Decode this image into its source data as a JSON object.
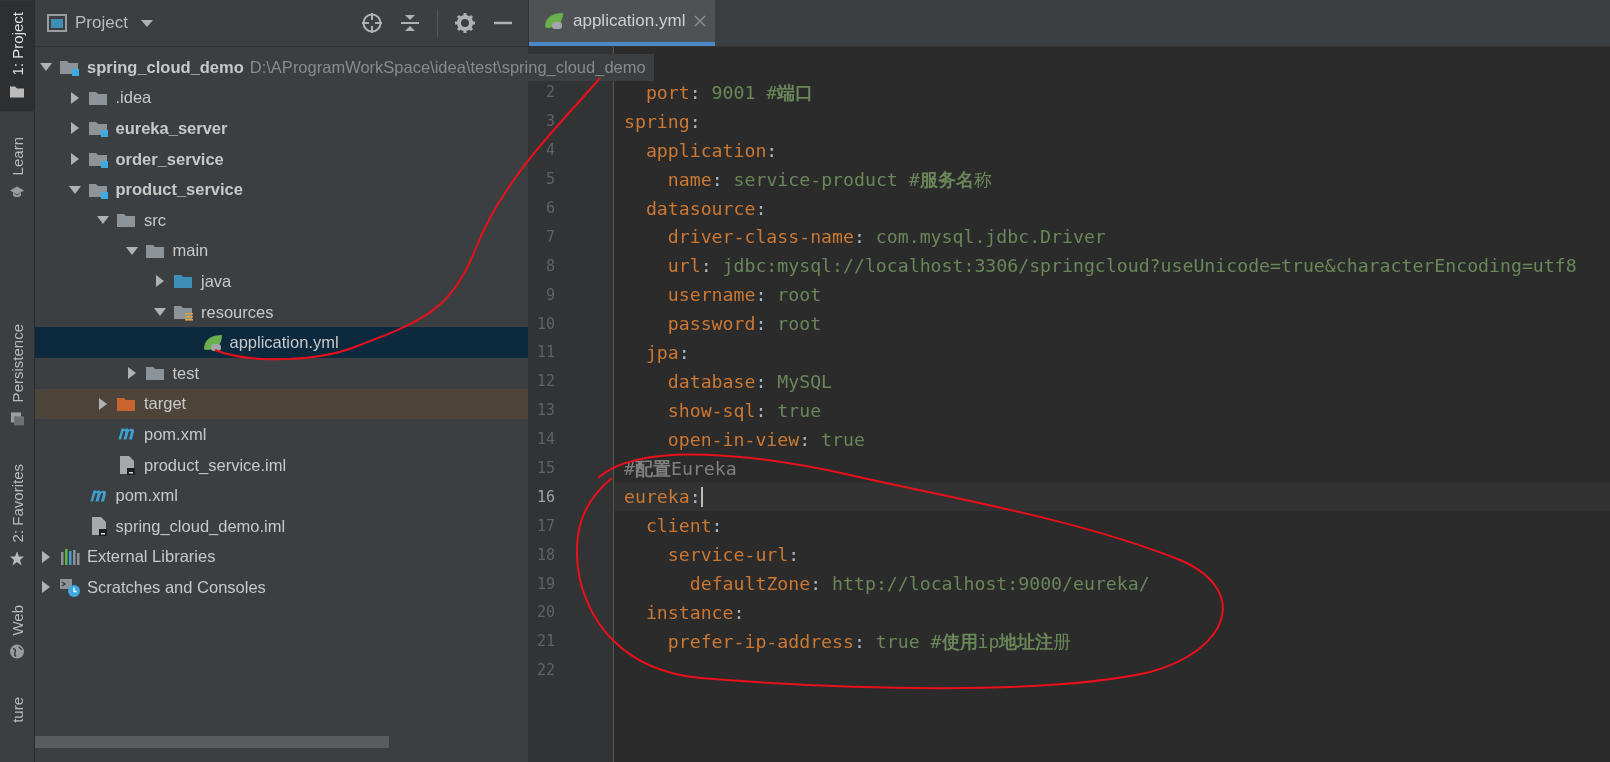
{
  "tool_tabs": [
    {
      "label": "1: Project",
      "selected": true
    },
    {
      "label": "Learn",
      "selected": false
    },
    {
      "label": "Persistence",
      "selected": false
    },
    {
      "label": "2: Favorites",
      "selected": false
    },
    {
      "label": "Web",
      "selected": false
    },
    {
      "label": "ture",
      "selected": false
    }
  ],
  "project_panel": {
    "title": "Project",
    "tree": [
      {
        "label": "spring_cloud_demo",
        "path": "D:\\AProgramWorkSpace\\idea\\test\\spring_cloud_demo",
        "kind": "module",
        "bold": true,
        "expanded": true,
        "selected": false,
        "children": [
          {
            "label": ".idea",
            "kind": "folder",
            "bold": false,
            "expanded": false,
            "selected": false
          },
          {
            "label": "eureka_server",
            "kind": "module",
            "bold": true,
            "expanded": false,
            "selected": false
          },
          {
            "label": "order_service",
            "kind": "module",
            "bold": true,
            "expanded": false,
            "selected": false
          },
          {
            "label": "product_service",
            "kind": "module",
            "bold": true,
            "expanded": true,
            "selected": false,
            "children": [
              {
                "label": "src",
                "kind": "folder",
                "bold": false,
                "expanded": true,
                "selected": false,
                "children": [
                  {
                    "label": "main",
                    "kind": "folder",
                    "bold": false,
                    "expanded": true,
                    "selected": false,
                    "children": [
                      {
                        "label": "java",
                        "kind": "source",
                        "bold": false,
                        "expanded": false,
                        "selected": false
                      },
                      {
                        "label": "resources",
                        "kind": "resources",
                        "bold": false,
                        "expanded": true,
                        "selected": false,
                        "children": [
                          {
                            "label": "application.yml",
                            "kind": "spring",
                            "bold": false,
                            "selected": true
                          }
                        ]
                      }
                    ]
                  },
                  {
                    "label": "test",
                    "kind": "folder",
                    "bold": false,
                    "expanded": false,
                    "selected": false
                  }
                ]
              },
              {
                "label": "target",
                "kind": "excluded",
                "bold": false,
                "expanded": false,
                "selected": false,
                "highlighted": true
              },
              {
                "label": "pom.xml",
                "kind": "maven",
                "bold": false,
                "selected": false
              },
              {
                "label": "product_service.iml",
                "kind": "iml",
                "bold": false,
                "selected": false
              }
            ]
          },
          {
            "label": "pom.xml",
            "kind": "maven",
            "bold": false,
            "selected": false
          },
          {
            "label": "spring_cloud_demo.iml",
            "kind": "iml",
            "bold": false,
            "selected": false
          }
        ]
      },
      {
        "label": "External Libraries",
        "kind": "libraries",
        "bold": false,
        "expanded": false,
        "selected": false
      },
      {
        "label": "Scratches and Consoles",
        "kind": "scratches",
        "bold": false,
        "expanded": false,
        "selected": false
      }
    ]
  },
  "editor": {
    "tabs": [
      {
        "label": "application.yml",
        "selected": true
      }
    ],
    "lines": [
      {
        "children": [
          {
            "number": "2",
            "key": "port",
            "sep": ":",
            "value": " 9001 #**端口**",
            "current": false
          }
        ]
      },
      {
        "number": "3",
        "key": "spring",
        "sep": ":",
        "current": false,
        "children": [
          {
            "number": "4",
            "key": "application",
            "sep": ":",
            "current": false,
            "children": [
              {
                "number": "5",
                "key": "name",
                "sep": ":",
                "value": " service-product #**服务名**称",
                "current": false
              }
            ]
          },
          {
            "number": "6",
            "key": "datasource",
            "sep": ":",
            "current": false,
            "children": [
              {
                "number": "7",
                "key": "driver-class-name",
                "sep": ":",
                "value": " com.mysql.jdbc.Driver",
                "current": false
              },
              {
                "number": "8",
                "key": "url",
                "sep": ":",
                "value": " jdbc:mysql://localhost:3306/springcloud?useUnicode=true&characterEncoding=utf8",
                "current": false
              },
              {
                "number": "9",
                "key": "username",
                "sep": ":",
                "value": " root",
                "current": false
              },
              {
                "number": "10",
                "key": "password",
                "sep": ":",
                "value": " root",
                "current": false
              }
            ]
          },
          {
            "number": "11",
            "key": "jpa",
            "sep": ":",
            "current": false,
            "children": [
              {
                "number": "12",
                "key": "database",
                "sep": ":",
                "value": " MySQL",
                "current": false
              },
              {
                "number": "13",
                "key": "show-sql",
                "sep": ":",
                "value": " true",
                "current": false
              },
              {
                "number": "14",
                "key": "open-in-view",
                "sep": ":",
                "value": " true",
                "current": false
              }
            ]
          }
        ]
      },
      {
        "number": "15",
        "comment": "#**配置**Eureka",
        "current": false
      },
      {
        "number": "16",
        "key": "eureka",
        "sep": ":",
        "current": true,
        "children": [
          {
            "number": "17",
            "key": "client",
            "sep": ":",
            "current": false,
            "children": [
              {
                "number": "18",
                "key": "service-url",
                "sep": ":",
                "current": false,
                "children": [
                  {
                    "number": "19",
                    "key": "defaultZone",
                    "sep": ":",
                    "value": " http://localhost:9000/eureka/",
                    "current": false
                  }
                ]
              }
            ]
          },
          {
            "number": "20",
            "key": "instance",
            "sep": ":",
            "current": false,
            "children": [
              {
                "number": "21",
                "key": "prefer-ip-address",
                "sep": ":",
                "value": " true #**使用**ip**地址注**册",
                "current": false
              }
            ]
          }
        ]
      },
      {
        "number": "22",
        "current": false
      }
    ]
  }
}
